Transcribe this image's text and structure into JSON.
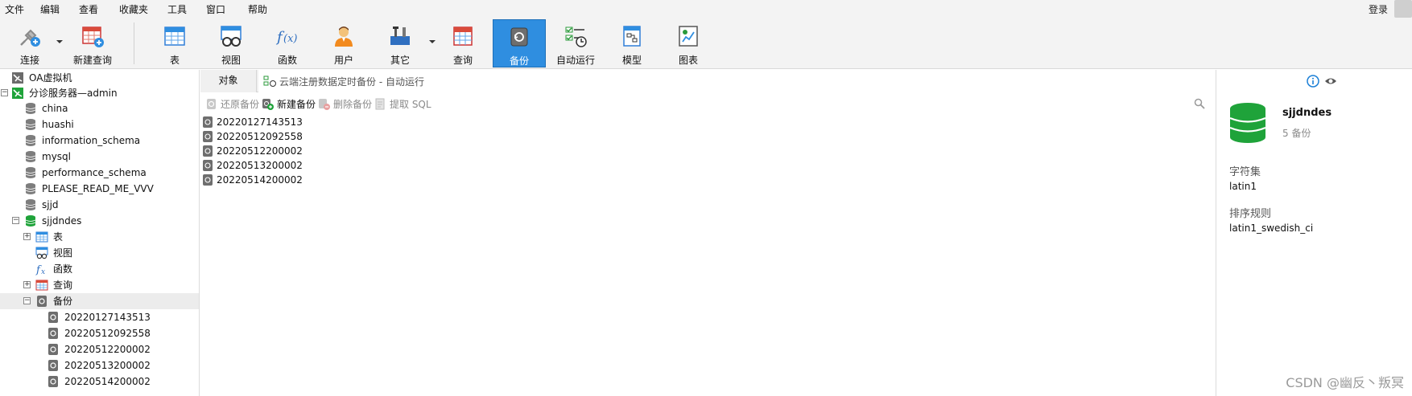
{
  "colors": {
    "active_button_bg": "#2f8ee0",
    "db_green": "#1fa33a",
    "db_gray": "#7d7d7d",
    "info_blue": "#1b7fd6"
  },
  "menu": [
    "文件",
    "编辑",
    "查看",
    "收藏夹",
    "工具",
    "窗口",
    "帮助"
  ],
  "login_label": "登录",
  "toolbar": {
    "connect": "连接",
    "new_query": "新建查询",
    "table": "表",
    "view": "视图",
    "function": "函数",
    "user": "用户",
    "other": "其它",
    "query": "查询",
    "backup": "备份",
    "auto_run": "自动运行",
    "model": "模型",
    "chart": "图表"
  },
  "tree": {
    "vm": "OA虚拟机",
    "server": "分诊服务器—admin",
    "databases": [
      "china",
      "huashi",
      "information_schema",
      "mysql",
      "performance_schema",
      "PLEASE_READ_ME_VVV",
      "sjjd"
    ],
    "open_db": "sjjdndes",
    "children": {
      "tables": "表",
      "views": "视图",
      "functions": "函数",
      "queries": "查询",
      "backups": "备份"
    },
    "backups": [
      "20220127143513",
      "20220512092558",
      "20220512200002",
      "20220513200002",
      "20220514200002"
    ]
  },
  "tabs": {
    "object": "对象",
    "auto_run": "云端注册数据定时备份 - 自动运行"
  },
  "subtoolbar": {
    "restore": "还原备份",
    "new_backup": "新建备份",
    "delete_backup": "删除备份",
    "extract_sql": "提取 SQL"
  },
  "files": [
    "20220127143513",
    "20220512092558",
    "20220512200002",
    "20220513200002",
    "20220514200002"
  ],
  "info": {
    "db_name": "sjjdndes",
    "count": "5 备份",
    "charset_key": "字符集",
    "charset_val": "latin1",
    "collation_key": "排序规则",
    "collation_val": "latin1_swedish_ci"
  },
  "watermark": "CSDN @幽反丶叛冥"
}
